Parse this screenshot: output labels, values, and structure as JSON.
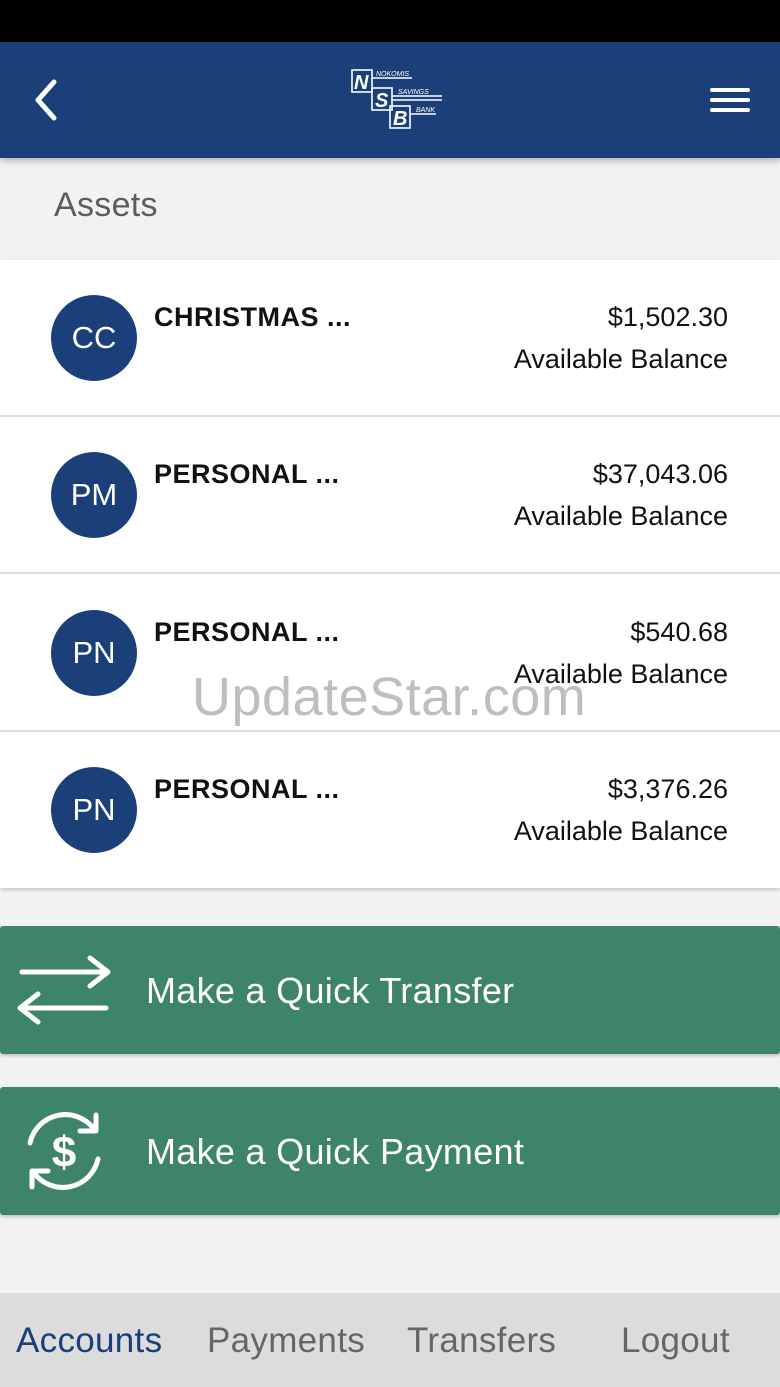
{
  "header": {
    "back_icon": "chevron-left-icon",
    "menu_icon": "hamburger-menu-icon",
    "logo": {
      "letters": [
        "N",
        "S",
        "B"
      ],
      "words": [
        "NOKOMIS",
        "SAVINGS",
        "BANK"
      ]
    },
    "brand_color": "#1b3f79"
  },
  "section": {
    "title": "Assets"
  },
  "accounts": [
    {
      "initials": "CC",
      "name": "CHRISTMAS ...",
      "amount": "$1,502.30",
      "balance_label": "Available Balance"
    },
    {
      "initials": "PM",
      "name": "PERSONAL ...",
      "amount": "$37,043.06",
      "balance_label": "Available Balance"
    },
    {
      "initials": "PN",
      "name": "PERSONAL ...",
      "amount": "$540.68",
      "balance_label": "Available Balance"
    },
    {
      "initials": "PN",
      "name": "PERSONAL ...",
      "amount": "$3,376.26",
      "balance_label": "Available Balance"
    }
  ],
  "actions": {
    "transfer": {
      "label": "Make a Quick Transfer",
      "icon": "transfer-arrows-icon"
    },
    "payment": {
      "label": "Make a Quick Payment",
      "icon": "dollar-cycle-icon"
    },
    "color": "#3d8566"
  },
  "nav": {
    "items": [
      {
        "label": "Accounts",
        "active": true
      },
      {
        "label": "Payments",
        "active": false
      },
      {
        "label": "Transfers",
        "active": false
      },
      {
        "label": "Logout",
        "active": false
      }
    ],
    "active_color": "#1b3f79"
  },
  "watermark": "UpdateStar.com"
}
